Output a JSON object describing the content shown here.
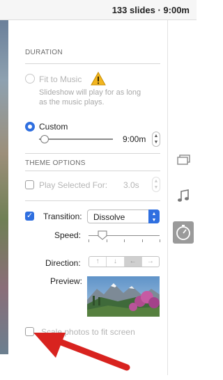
{
  "header": {
    "summary": "133 slides · 9:00m"
  },
  "duration": {
    "title": "DURATION",
    "fit_to_music": {
      "label": "Fit to Music",
      "selected": false,
      "warning_icon": "warning-icon",
      "note_line1": "Slideshow will play for as long",
      "note_line2": "as the music plays."
    },
    "custom": {
      "label": "Custom",
      "selected": true,
      "value": "9:00m",
      "slider_level": 0.08
    }
  },
  "theme_options": {
    "title": "THEME OPTIONS",
    "play_selected": {
      "label": "Play Selected For:",
      "checked": false,
      "value": "3.0s"
    },
    "transition": {
      "label": "Transition:",
      "checked": true,
      "value": "Dissolve"
    },
    "speed": {
      "label": "Speed:",
      "slider_level": 0.2
    },
    "direction": {
      "label": "Direction:",
      "options": [
        "↑",
        "↓",
        "←",
        "→"
      ],
      "selected_index": 2
    },
    "preview": {
      "label": "Preview:"
    }
  },
  "scale": {
    "label": "Scale photos to fit screen",
    "checked": false
  },
  "side_icons": [
    "slides-icon",
    "music-note-icon",
    "timer-icon"
  ],
  "colors": {
    "accent": "#2f6fe0",
    "arrow": "#d8231f",
    "warning": "#f2b51f"
  }
}
